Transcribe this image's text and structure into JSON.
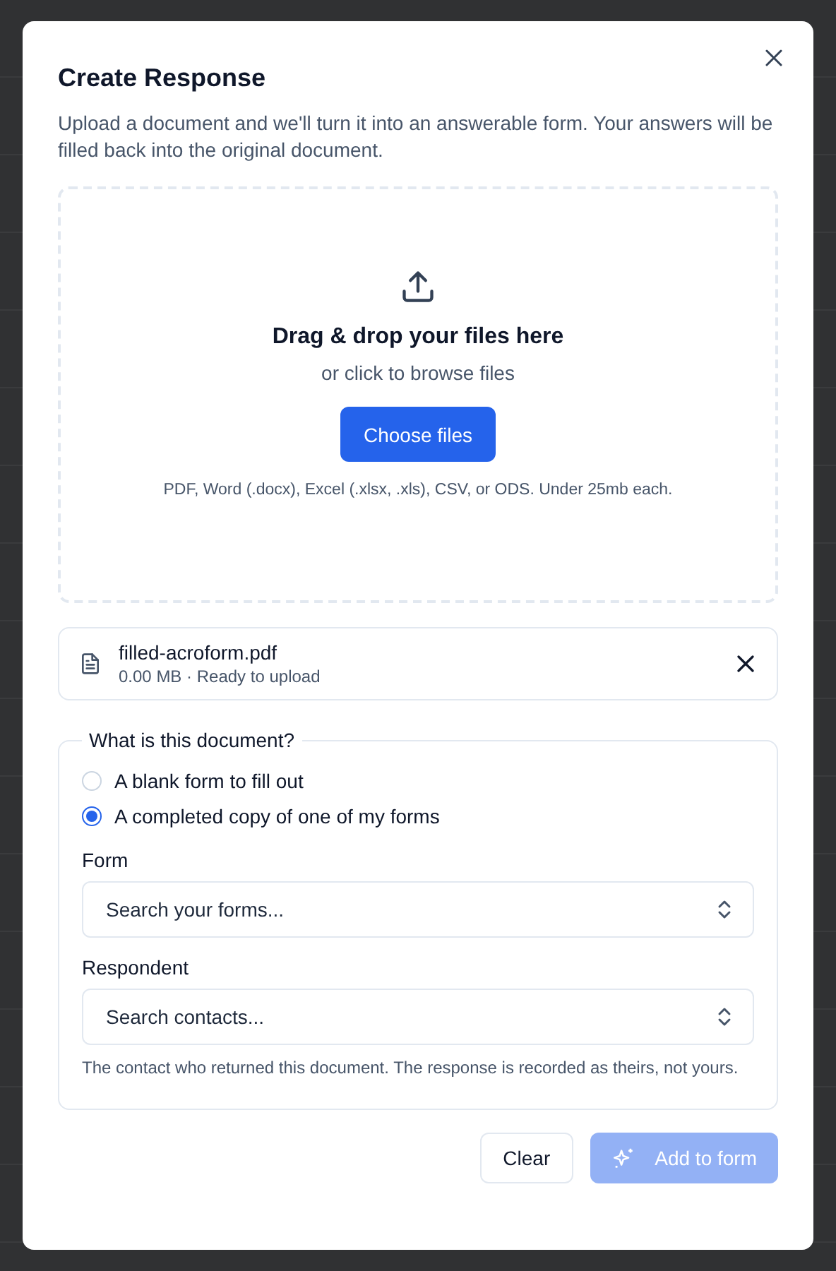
{
  "dialog": {
    "title": "Create Response",
    "description": "Upload a document and we'll turn it into an answerable form. Your answers will be filled back into the original document."
  },
  "dropzone": {
    "heading": "Drag & drop your files here",
    "subheading": "or click to browse files",
    "button": "Choose files",
    "hint": "PDF, Word (.docx), Excel (.xlsx, .xls), CSV, or ODS. Under 25mb each."
  },
  "files": [
    {
      "name": "filled-acroform.pdf",
      "meta": "0.00 MB · Ready to upload"
    }
  ],
  "document_type": {
    "legend": "What is this document?",
    "options": [
      {
        "label": "A blank form to fill out",
        "selected": false
      },
      {
        "label": "A completed copy of one of my forms",
        "selected": true
      }
    ]
  },
  "fields": [
    {
      "label": "Form",
      "placeholder": "Search your forms..."
    },
    {
      "label": "Respondent",
      "placeholder": "Search contacts...",
      "help": "The contact who returned this document. The response is recorded as theirs, not yours."
    }
  ],
  "actions": [
    {
      "label": "Clear",
      "kind": "secondary",
      "disabled": false
    },
    {
      "label": "Add to form",
      "kind": "primary",
      "disabled": true
    }
  ]
}
